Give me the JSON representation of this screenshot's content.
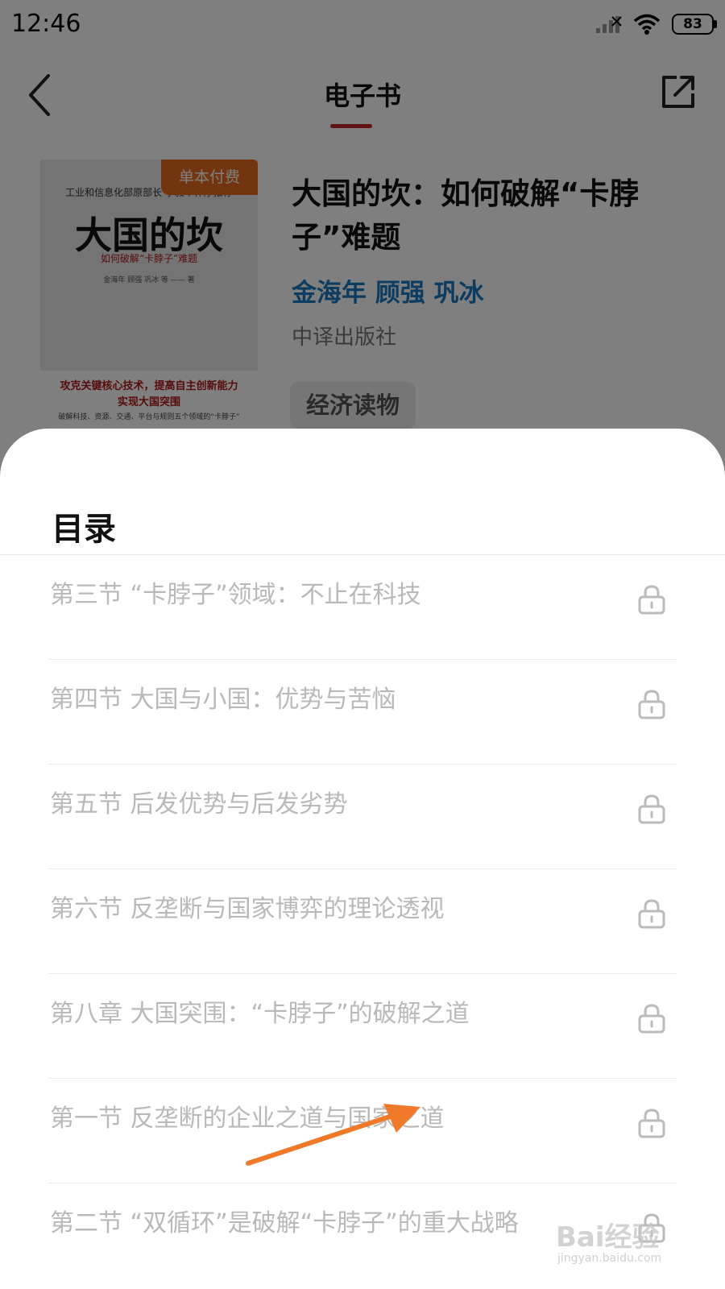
{
  "status_bar": {
    "time": "12:46",
    "battery": "83"
  },
  "header": {
    "title": "电子书"
  },
  "book": {
    "badge": "单本付费",
    "title": "大国的坎：如何破解“卡脖子”难题",
    "authors": "金海年 顾强 巩冰",
    "publisher": "中译出版社",
    "tag": "经济读物",
    "cover": {
      "top_line": "工业和信息化部原部长 李毅中作序推荐",
      "title": "大国的坎",
      "subtitle": "如何破解“卡脖子”难题",
      "authors": "金海年  顾强  巩冰  等 —— 著",
      "line1": "攻克关键核心技术，提高自主创新能力",
      "line2": "实现大国突围",
      "line3": "破解科技、资源、交通、平台与规则五个领域的“卡脖子”"
    }
  },
  "toc": {
    "title": "目录",
    "items": [
      {
        "label": "第三节 “卡脖子”领域：不止在科技",
        "icon": "lock-icon"
      },
      {
        "label": "第四节 大国与小国：优势与苦恼",
        "icon": "lock-icon"
      },
      {
        "label": "第五节 后发优势与后发劣势",
        "icon": "lock-icon"
      },
      {
        "label": "第六节 反垄断与国家博弈的理论透视",
        "icon": "lock-icon"
      },
      {
        "label": "第八章 大国突围：“卡脖子”的破解之道",
        "icon": "lock-icon"
      },
      {
        "label": "第一节 反垄断的企业之道与国家之道",
        "icon": "lock-icon"
      },
      {
        "label": "第二节 “双循环”是破解“卡脖子”的重大战略",
        "icon": "lock-icon"
      }
    ]
  },
  "watermark": {
    "main": "Bai经验",
    "sub": "jingyan.baidu.com"
  },
  "colors": {
    "accent": "#c2272d",
    "badge": "#e66a1e",
    "author": "#1a78c2",
    "arrow": "#f07a2a"
  }
}
